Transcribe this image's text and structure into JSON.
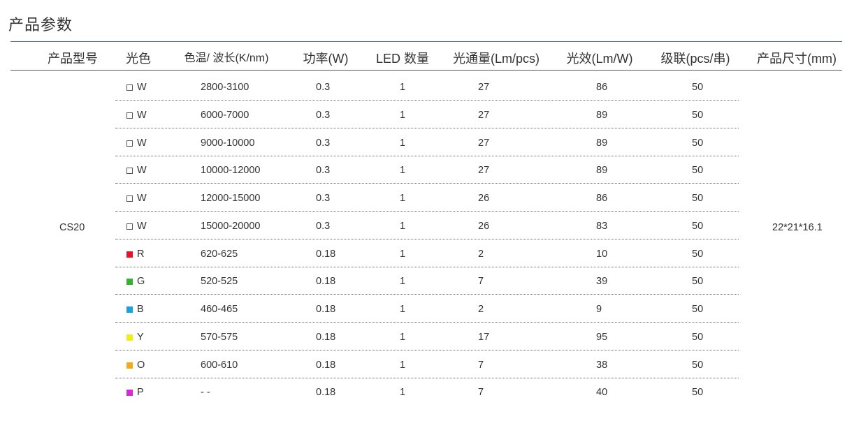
{
  "title": "产品参数",
  "headers": [
    "产品型号",
    "光色",
    "色温/ 波长(K/nm)",
    "功率(W)",
    "LED 数量",
    "光通量(Lm/pcs)",
    "光效(Lm/W)",
    "级联(pcs/串)",
    "产品尺寸(mm)"
  ],
  "model": "CS20",
  "size": "22*21*16.1",
  "rows": [
    {
      "color": "W",
      "swatch": "#ffffff",
      "cct": "2800-3100",
      "power": "0.3",
      "qty": "1",
      "flux": "27",
      "eff": "86",
      "cascade": "50"
    },
    {
      "color": "W",
      "swatch": "#ffffff",
      "cct": "6000-7000",
      "power": "0.3",
      "qty": "1",
      "flux": "27",
      "eff": "89",
      "cascade": "50"
    },
    {
      "color": "W",
      "swatch": "#ffffff",
      "cct": "9000-10000",
      "power": "0.3",
      "qty": "1",
      "flux": "27",
      "eff": "89",
      "cascade": "50"
    },
    {
      "color": "W",
      "swatch": "#ffffff",
      "cct": "10000-12000",
      "power": "0.3",
      "qty": "1",
      "flux": "27",
      "eff": "89",
      "cascade": "50"
    },
    {
      "color": "W",
      "swatch": "#ffffff",
      "cct": "12000-15000",
      "power": "0.3",
      "qty": "1",
      "flux": "26",
      "eff": "86",
      "cascade": "50"
    },
    {
      "color": "W",
      "swatch": "#ffffff",
      "cct": "15000-20000",
      "power": "0.3",
      "qty": "1",
      "flux": "26",
      "eff": "83",
      "cascade": "50"
    },
    {
      "color": "R",
      "swatch": "#e5132a",
      "cct": "620-625",
      "power": "0.18",
      "qty": "1",
      "flux": "2",
      "eff": "10",
      "cascade": "50"
    },
    {
      "color": "G",
      "swatch": "#35b233",
      "cct": "520-525",
      "power": "0.18",
      "qty": "1",
      "flux": "7",
      "eff": "39",
      "cascade": "50"
    },
    {
      "color": "B",
      "swatch": "#1ba1d9",
      "cct": "460-465",
      "power": "0.18",
      "qty": "1",
      "flux": "2",
      "eff": "9",
      "cascade": "50"
    },
    {
      "color": "Y",
      "swatch": "#f2ec1c",
      "cct": "570-575",
      "power": "0.18",
      "qty": "1",
      "flux": "17",
      "eff": "95",
      "cascade": "50"
    },
    {
      "color": "O",
      "swatch": "#f1a81c",
      "cct": "600-610",
      "power": "0.18",
      "qty": "1",
      "flux": "7",
      "eff": "38",
      "cascade": "50"
    },
    {
      "color": "P",
      "swatch": "#d62ad6",
      "cct": "- -",
      "power": "0.18",
      "qty": "1",
      "flux": "7",
      "eff": "40",
      "cascade": "50"
    }
  ]
}
